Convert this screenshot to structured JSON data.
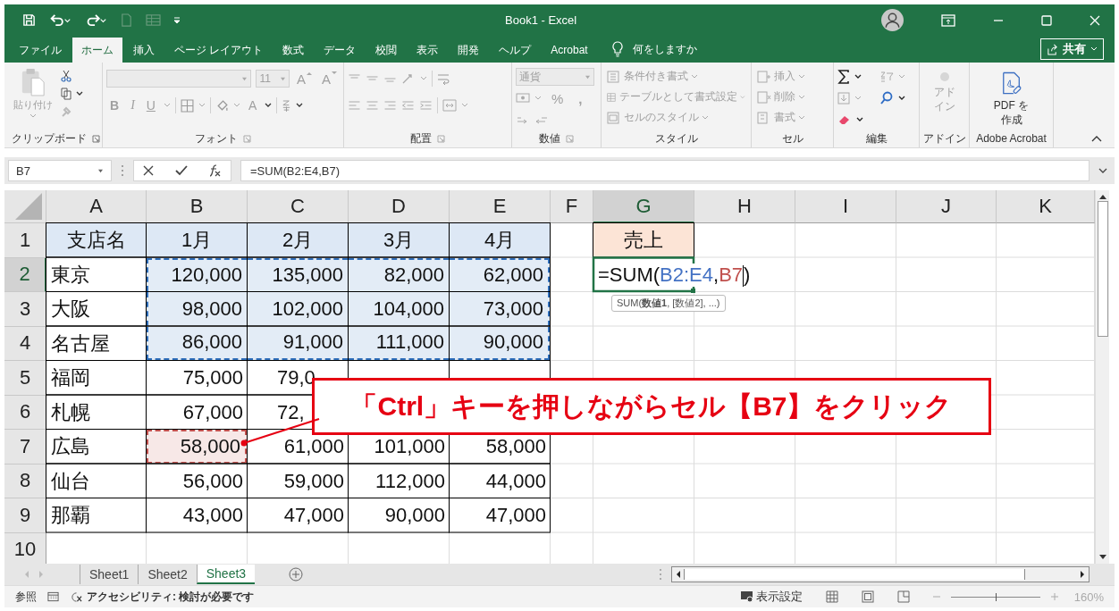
{
  "window": {
    "title": "Book1  -  Excel"
  },
  "quick_access": [
    {
      "kind": "save",
      "disabled": false
    },
    {
      "kind": "undo",
      "disabled": false
    },
    {
      "kind": "redo",
      "disabled": false
    },
    {
      "kind": "new",
      "disabled": true
    },
    {
      "kind": "form",
      "disabled": true
    }
  ],
  "tabs": [
    {
      "label": "ファイル",
      "selected": false
    },
    {
      "label": "ホーム",
      "selected": true
    },
    {
      "label": "挿入",
      "selected": false
    },
    {
      "label": "ページ レイアウト",
      "selected": false
    },
    {
      "label": "数式",
      "selected": false
    },
    {
      "label": "データ",
      "selected": false
    },
    {
      "label": "校閲",
      "selected": false
    },
    {
      "label": "表示",
      "selected": false
    },
    {
      "label": "開発",
      "selected": false
    },
    {
      "label": "ヘルプ",
      "selected": false
    },
    {
      "label": "Acrobat",
      "selected": false
    }
  ],
  "tell_me": "何をしますか",
  "share_button": "共有",
  "ribbon": {
    "clipboard": {
      "label": "クリップボード",
      "paste": "貼り付け"
    },
    "font": {
      "label": "フォント",
      "size": "11",
      "grow": "A",
      "shrink": "A",
      "bold": "B",
      "italic": "I",
      "underline": "U",
      "font_color": "A"
    },
    "alignment": {
      "label": "配置"
    },
    "number": {
      "label": "数値",
      "format": "通貨",
      "percent": "%",
      "comma": ","
    },
    "styles": {
      "label": "スタイル",
      "items": [
        "条件付き書式",
        "テーブルとして書式設定",
        "セルのスタイル"
      ]
    },
    "cells": {
      "label": "セル",
      "items": [
        "挿入",
        "削除",
        "書式"
      ]
    },
    "editing": {
      "label": "編集"
    },
    "addins": {
      "label": "アドイン",
      "button": "アドイン"
    },
    "acrobat": {
      "label": "Adobe Acrobat",
      "button": "PDF を作成"
    }
  },
  "formula_bar": {
    "name_box": "B7",
    "formula": "=SUM(B2:E4,B7)"
  },
  "sheet": {
    "columns": [
      {
        "label": "A",
        "selected": false
      },
      {
        "label": "B",
        "selected": false
      },
      {
        "label": "C",
        "selected": false
      },
      {
        "label": "D",
        "selected": false
      },
      {
        "label": "E",
        "selected": false
      },
      {
        "label": "F",
        "selected": false
      },
      {
        "label": "G",
        "selected": true
      },
      {
        "label": "H",
        "selected": false
      },
      {
        "label": "I",
        "selected": false
      },
      {
        "label": "J",
        "selected": false
      },
      {
        "label": "K",
        "selected": false
      }
    ],
    "rows": [
      {
        "label": "1",
        "selected": false,
        "cells": [
          {
            "kind": "heading",
            "text": "支店名"
          },
          {
            "kind": "heading",
            "text": "1月"
          },
          {
            "kind": "heading",
            "text": "2月"
          },
          {
            "kind": "heading",
            "text": "3月"
          },
          {
            "kind": "heading",
            "text": "4月"
          },
          {
            "kind": "blank"
          },
          {
            "kind": "label",
            "text": "売上"
          },
          {
            "kind": "blank"
          },
          {
            "kind": "blank"
          },
          {
            "kind": "blank"
          },
          {
            "kind": "blank"
          }
        ]
      },
      {
        "label": "2",
        "selected": true,
        "cells": [
          {
            "kind": "text",
            "text": "東京"
          },
          {
            "kind": "ranged",
            "text": "120,000"
          },
          {
            "kind": "ranged",
            "text": "135,000"
          },
          {
            "kind": "ranged",
            "text": "82,000"
          },
          {
            "kind": "ranged",
            "text": "62,000"
          },
          {
            "kind": "blank"
          },
          {
            "kind": "formula"
          },
          {
            "kind": "blank"
          },
          {
            "kind": "blank"
          },
          {
            "kind": "blank"
          },
          {
            "kind": "blank"
          }
        ]
      },
      {
        "label": "3",
        "selected": false,
        "cells": [
          {
            "kind": "text",
            "text": "大阪"
          },
          {
            "kind": "ranged",
            "text": "98,000"
          },
          {
            "kind": "ranged",
            "text": "102,000"
          },
          {
            "kind": "ranged",
            "text": "104,000"
          },
          {
            "kind": "ranged",
            "text": "73,000"
          },
          {
            "kind": "blank"
          },
          {
            "kind": "blank"
          },
          {
            "kind": "blank"
          },
          {
            "kind": "blank"
          },
          {
            "kind": "blank"
          },
          {
            "kind": "blank"
          }
        ]
      },
      {
        "label": "4",
        "selected": false,
        "cells": [
          {
            "kind": "text",
            "text": "名古屋"
          },
          {
            "kind": "ranged",
            "text": "86,000"
          },
          {
            "kind": "ranged",
            "text": "91,000"
          },
          {
            "kind": "ranged",
            "text": "111,000"
          },
          {
            "kind": "ranged",
            "text": "90,000"
          },
          {
            "kind": "blank"
          },
          {
            "kind": "blank"
          },
          {
            "kind": "blank"
          },
          {
            "kind": "blank"
          },
          {
            "kind": "blank"
          },
          {
            "kind": "blank"
          }
        ]
      },
      {
        "label": "5",
        "selected": false,
        "cells": [
          {
            "kind": "text",
            "text": "福岡"
          },
          {
            "kind": "number",
            "text": "75,000"
          },
          {
            "kind": "cut",
            "text": "79,0"
          },
          {
            "kind": "covered"
          },
          {
            "kind": "covered"
          },
          {
            "kind": "blank"
          },
          {
            "kind": "blank"
          },
          {
            "kind": "blank"
          },
          {
            "kind": "blank"
          },
          {
            "kind": "blank"
          },
          {
            "kind": "blank"
          }
        ]
      },
      {
        "label": "6",
        "selected": false,
        "cells": [
          {
            "kind": "text",
            "text": "札幌"
          },
          {
            "kind": "number",
            "text": "67,000"
          },
          {
            "kind": "cut",
            "text": "72,"
          },
          {
            "kind": "covered"
          },
          {
            "kind": "covered"
          },
          {
            "kind": "blank"
          },
          {
            "kind": "blank"
          },
          {
            "kind": "blank"
          },
          {
            "kind": "blank"
          },
          {
            "kind": "blank"
          },
          {
            "kind": "blank"
          }
        ]
      },
      {
        "label": "7",
        "selected": false,
        "cells": [
          {
            "kind": "text",
            "text": "広島"
          },
          {
            "kind": "picked",
            "text": "58,000"
          },
          {
            "kind": "number",
            "text": "61,000"
          },
          {
            "kind": "number",
            "text": "101,000"
          },
          {
            "kind": "number",
            "text": "58,000"
          },
          {
            "kind": "blank"
          },
          {
            "kind": "blank"
          },
          {
            "kind": "blank"
          },
          {
            "kind": "blank"
          },
          {
            "kind": "blank"
          },
          {
            "kind": "blank"
          }
        ]
      },
      {
        "label": "8",
        "selected": false,
        "cells": [
          {
            "kind": "text",
            "text": "仙台"
          },
          {
            "kind": "number",
            "text": "56,000"
          },
          {
            "kind": "number",
            "text": "59,000"
          },
          {
            "kind": "number",
            "text": "112,000"
          },
          {
            "kind": "number",
            "text": "44,000"
          },
          {
            "kind": "blank"
          },
          {
            "kind": "blank"
          },
          {
            "kind": "blank"
          },
          {
            "kind": "blank"
          },
          {
            "kind": "blank"
          },
          {
            "kind": "blank"
          }
        ]
      },
      {
        "label": "9",
        "selected": false,
        "cells": [
          {
            "kind": "text",
            "text": "那覇"
          },
          {
            "kind": "number",
            "text": "43,000"
          },
          {
            "kind": "number",
            "text": "47,000"
          },
          {
            "kind": "number",
            "text": "90,000"
          },
          {
            "kind": "number",
            "text": "47,000"
          },
          {
            "kind": "blank"
          },
          {
            "kind": "blank"
          },
          {
            "kind": "blank"
          },
          {
            "kind": "blank"
          },
          {
            "kind": "blank"
          },
          {
            "kind": "blank"
          }
        ]
      },
      {
        "label": "10",
        "selected": false,
        "cells": [
          {
            "kind": "blank"
          },
          {
            "kind": "blank"
          },
          {
            "kind": "blank"
          },
          {
            "kind": "blank"
          },
          {
            "kind": "blank"
          },
          {
            "kind": "blank"
          },
          {
            "kind": "blank"
          },
          {
            "kind": "blank"
          },
          {
            "kind": "blank"
          },
          {
            "kind": "blank"
          },
          {
            "kind": "blank"
          }
        ]
      }
    ],
    "formula_parts": [
      {
        "text": "=SUM(",
        "cursor_after": false
      },
      {
        "text": "B2:E4",
        "color": "#4472c4",
        "cursor_after": false
      },
      {
        "text": ",",
        "cursor_after": false
      },
      {
        "text": "B7",
        "color": "#c0504d",
        "cursor_after": true
      },
      {
        "text": ")",
        "cursor_after": false
      }
    ],
    "formula_hint": "SUM(**数値1**, [数値2], ...)"
  },
  "callout": {
    "text": "「Ctrl」キーを押しながらセル【B7】をクリック"
  },
  "sheet_tabs": [
    {
      "label": "Sheet1",
      "selected": false
    },
    {
      "label": "Sheet2",
      "selected": false
    },
    {
      "label": "Sheet3",
      "selected": true
    }
  ],
  "status_bar": {
    "mode": "参照",
    "accessibility": "アクセシビリティ: 検討が必要です",
    "display_settings": "表示設定",
    "zoom": "160%",
    "zoom_slider": {
      "level": 0.5
    }
  }
}
